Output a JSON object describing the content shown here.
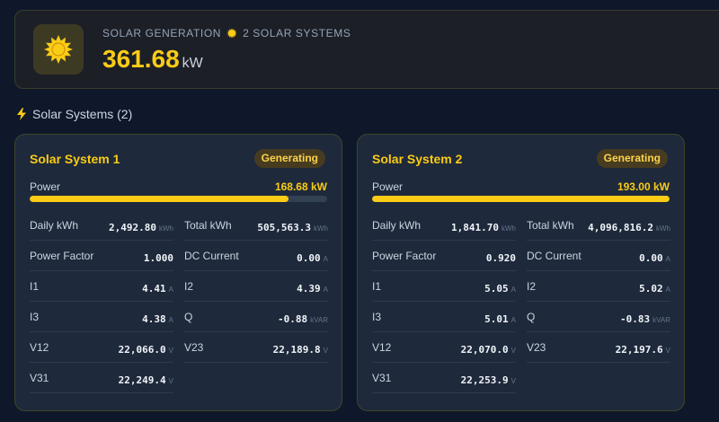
{
  "header": {
    "label": "SOLAR GENERATION",
    "systems_count_label": "2 SOLAR SYSTEMS",
    "total_value": "361.68",
    "total_unit": "kW"
  },
  "section": {
    "title": "Solar Systems (2)"
  },
  "colors": {
    "accent": "#facc15",
    "background": "#0f172a",
    "card": "#1e293b"
  },
  "icons": {
    "header": "sun-icon",
    "sub": "sun-small-icon",
    "section": "lightning-bolt-icon"
  },
  "systems": [
    {
      "name": "Solar System 1",
      "status": "Generating",
      "power_label": "Power",
      "power_value": "168.68 kW",
      "power_fraction": 0.87,
      "metrics": [
        {
          "label": "Daily kWh",
          "value": "2,492.80",
          "unit": "kWh"
        },
        {
          "label": "Total kWh",
          "value": "505,563.3",
          "unit": "kWh"
        },
        {
          "label": "Power Factor",
          "value": "1.000",
          "unit": ""
        },
        {
          "label": "DC Current",
          "value": "0.00",
          "unit": "A"
        },
        {
          "label": "I1",
          "value": "4.41",
          "unit": "A"
        },
        {
          "label": "I2",
          "value": "4.39",
          "unit": "A"
        },
        {
          "label": "I3",
          "value": "4.38",
          "unit": "A"
        },
        {
          "label": "Q",
          "value": "-0.88",
          "unit": "kVAR"
        },
        {
          "label": "V12",
          "value": "22,066.0",
          "unit": "V"
        },
        {
          "label": "V23",
          "value": "22,189.8",
          "unit": "V"
        },
        {
          "label": "V31",
          "value": "22,249.4",
          "unit": "V"
        }
      ]
    },
    {
      "name": "Solar System 2",
      "status": "Generating",
      "power_label": "Power",
      "power_value": "193.00 kW",
      "power_fraction": 1.0,
      "metrics": [
        {
          "label": "Daily kWh",
          "value": "1,841.70",
          "unit": "kWh"
        },
        {
          "label": "Total kWh",
          "value": "4,096,816.2",
          "unit": "kWh"
        },
        {
          "label": "Power Factor",
          "value": "0.920",
          "unit": ""
        },
        {
          "label": "DC Current",
          "value": "0.00",
          "unit": "A"
        },
        {
          "label": "I1",
          "value": "5.05",
          "unit": "A"
        },
        {
          "label": "I2",
          "value": "5.02",
          "unit": "A"
        },
        {
          "label": "I3",
          "value": "5.01",
          "unit": "A"
        },
        {
          "label": "Q",
          "value": "-0.83",
          "unit": "kVAR"
        },
        {
          "label": "V12",
          "value": "22,070.0",
          "unit": "V"
        },
        {
          "label": "V23",
          "value": "22,197.6",
          "unit": "V"
        },
        {
          "label": "V31",
          "value": "22,253.9",
          "unit": "V"
        }
      ]
    }
  ]
}
